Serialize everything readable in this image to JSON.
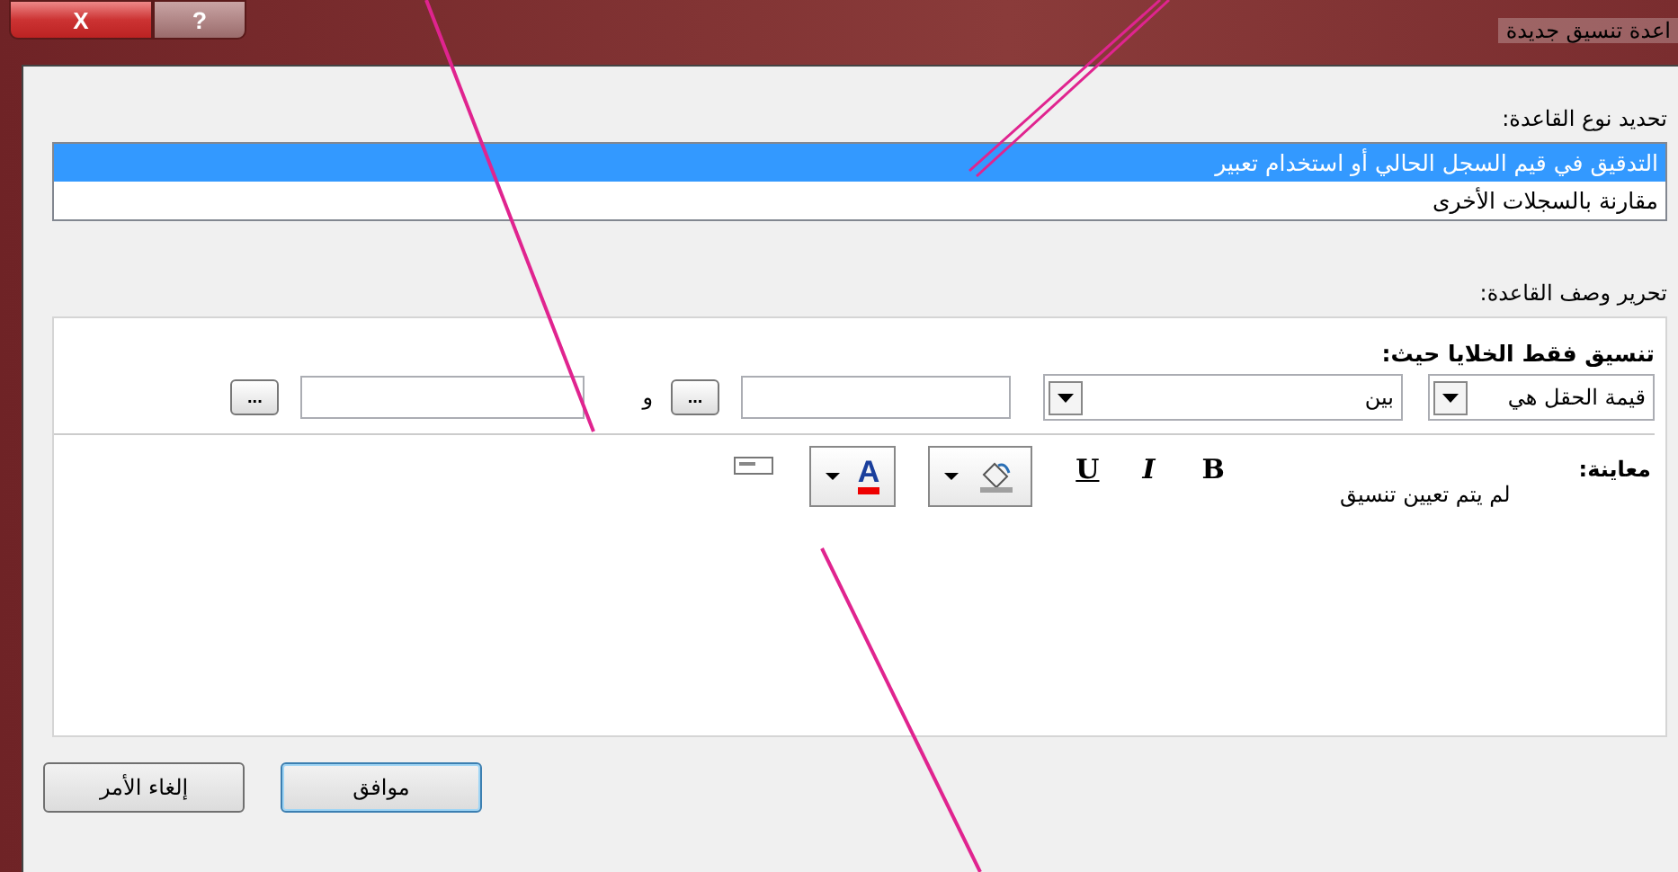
{
  "window": {
    "title": "اعدة تنسيق جديدة",
    "close_label": "X",
    "help_label": "?"
  },
  "rule_type": {
    "label": "تحديد نوع القاعدة:",
    "items": [
      {
        "label": "التدقيق في قيم السجل الحالي أو استخدام تعبير",
        "selected": true
      },
      {
        "label": "مقارنة بالسجلات الأخرى",
        "selected": false
      }
    ]
  },
  "rule_description": {
    "label": "تحرير وصف القاعدة:",
    "heading": "تنسيق فقط الخلايا حيث:",
    "field_combo": {
      "value": "قيمة الحقل هي"
    },
    "operator_combo": {
      "value": "بين"
    },
    "builder_button_1": "...",
    "connector": "و",
    "builder_button_2": "..."
  },
  "preview": {
    "label": "معاينة:",
    "text": "لم يتم تعيين تنسيق",
    "bold": "B",
    "italic": "I",
    "underline": "U",
    "font_color_letter": "A"
  },
  "buttons": {
    "ok": "موافق",
    "cancel": "إلغاء الأمر"
  }
}
